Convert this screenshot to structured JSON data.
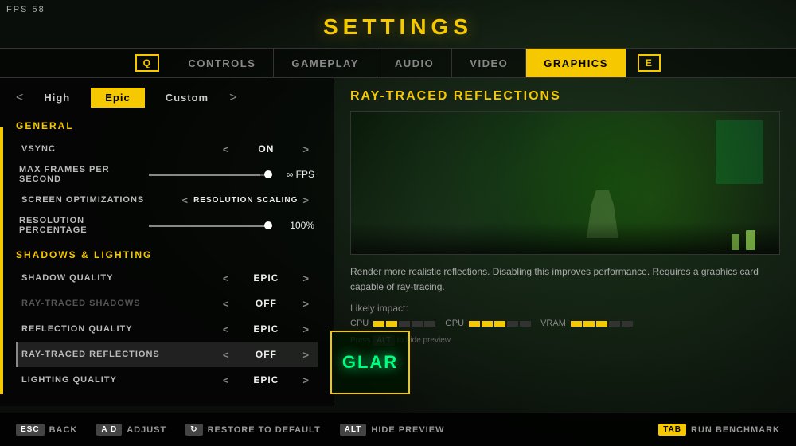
{
  "fps": {
    "label": "FPS",
    "value": "58"
  },
  "title": "SETTINGS",
  "nav": {
    "left_key": "Q",
    "right_key": "E",
    "items": [
      {
        "id": "controls",
        "label": "CONTROLS",
        "active": false
      },
      {
        "id": "gameplay",
        "label": "GAMEPLAY",
        "active": false
      },
      {
        "id": "audio",
        "label": "AUDIO",
        "active": false
      },
      {
        "id": "video",
        "label": "VIDEO",
        "active": false
      },
      {
        "id": "graphics",
        "label": "GRAPHICS",
        "active": true
      }
    ]
  },
  "presets": {
    "prev_arrow": "<",
    "next_arrow": ">",
    "options": [
      "High",
      "Epic",
      "Custom"
    ],
    "active": "Epic"
  },
  "general": {
    "header": "GENERAL",
    "settings": [
      {
        "label": "VSYNC",
        "value": "On",
        "dimmed": false
      },
      {
        "label": "MAX FRAMES PER SECOND",
        "value": "∞ FPS",
        "type": "slider",
        "fill": 100
      },
      {
        "label": "SCREEN OPTIMIZATIONS",
        "value": "RESOLUTION SCALING"
      },
      {
        "label": "RESOLUTION PERCENTAGE",
        "value": "100%",
        "type": "slider",
        "fill": 100
      }
    ]
  },
  "shadows": {
    "header": "SHADOWS & LIGHTING",
    "settings": [
      {
        "label": "SHADOW QUALITY",
        "value": "Epic",
        "dimmed": false,
        "highlighted": false
      },
      {
        "label": "RAY-TRACED SHADOWS",
        "value": "Off",
        "dimmed": true,
        "highlighted": false
      },
      {
        "label": "REFLECTION QUALITY",
        "value": "Epic",
        "dimmed": false,
        "highlighted": false
      },
      {
        "label": "RAY-TRACED REFLECTIONS",
        "value": "Off",
        "dimmed": false,
        "highlighted": true
      },
      {
        "label": "LIGHTING QUALITY",
        "value": "Epic",
        "dimmed": false,
        "highlighted": false
      }
    ]
  },
  "preview": {
    "title": "RAY-TRACED REFLECTIONS",
    "description": "Render more realistic reflections. Disabling this improves performance. Requires a graphics card capable of ray-tracing.",
    "impact_label": "Likely impact:",
    "metrics": [
      {
        "label": "CPU",
        "bars": 2,
        "total": 5
      },
      {
        "label": "GPU",
        "bars": 3,
        "total": 5
      },
      {
        "label": "VRAM",
        "bars": 3,
        "total": 5
      }
    ],
    "hint_key": "ALT",
    "hint_text": "to hide preview"
  },
  "game_panel": {
    "text": "GLAR"
  },
  "bottom": {
    "actions": [
      {
        "key": "ESC",
        "key_style": "normal",
        "label": "BACK"
      },
      {
        "key": "A D",
        "key_style": "normal",
        "label": "ADJUST"
      },
      {
        "key": "⟳",
        "key_style": "icon",
        "label": "RESTORE TO DEFAULT"
      },
      {
        "key": "ALT",
        "key_style": "normal",
        "label": "HIDE PREVIEW"
      }
    ],
    "right_action": {
      "key": "TAB",
      "label": "RUN BENCHMARK"
    }
  }
}
